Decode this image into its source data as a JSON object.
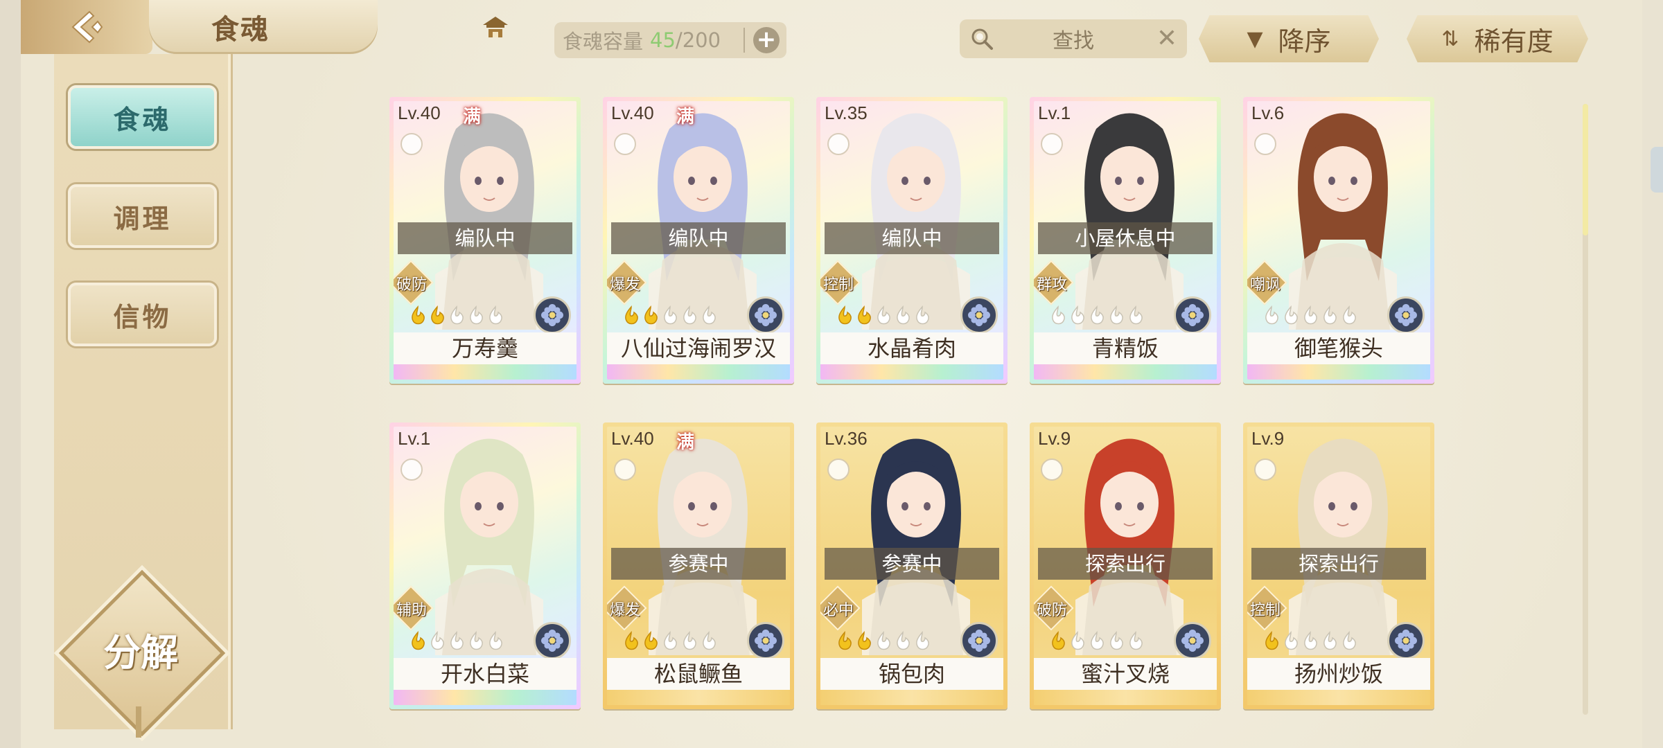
{
  "header": {
    "title": "食魂",
    "capacity_label": "食魂容量",
    "capacity_current": "45",
    "capacity_max": "/200",
    "search_placeholder": "查找",
    "sort_order_label": "降序",
    "sort_key_label": "稀有度"
  },
  "sidebar": {
    "items": [
      {
        "label": "食魂",
        "active": true
      },
      {
        "label": "调理",
        "active": false
      },
      {
        "label": "信物",
        "active": false
      }
    ],
    "decompose_label": "分解"
  },
  "colors": {
    "accent_active": "#8fd3ca",
    "capacity_current": "#8ecb72",
    "full_badge": "#c0251c"
  },
  "cards": [
    {
      "level": "Lv.40",
      "full": "满",
      "status": "编队中",
      "role": "破防",
      "name": "万寿羹",
      "frame": "rainbow",
      "stars": 2,
      "hair": "#bdbdbd"
    },
    {
      "level": "Lv.40",
      "full": "满",
      "status": "编队中",
      "role": "爆发",
      "name": "八仙过海闹罗汉",
      "frame": "rainbow",
      "stars": 2,
      "hair": "#b9c0e6"
    },
    {
      "level": "Lv.35",
      "full": "",
      "status": "编队中",
      "role": "控制",
      "name": "水晶肴肉",
      "frame": "rainbow",
      "stars": 2,
      "hair": "#e9e7ec"
    },
    {
      "level": "Lv.1",
      "full": "",
      "status": "小屋休息中",
      "role": "群攻",
      "name": "青精饭",
      "frame": "rainbow",
      "stars": 0,
      "hair": "#3a3a3c"
    },
    {
      "level": "Lv.6",
      "full": "",
      "status": "",
      "role": "嘲讽",
      "name": "御笔猴头",
      "frame": "rainbow",
      "stars": 0,
      "hair": "#8b4a2c"
    },
    {
      "level": "Lv.1",
      "full": "",
      "status": "",
      "role": "辅助",
      "name": "开水白菜",
      "frame": "rainbow",
      "stars": 1,
      "hair": "#dfe5c4"
    },
    {
      "level": "Lv.40",
      "full": "满",
      "status": "参赛中",
      "role": "爆发",
      "name": "松鼠鳜鱼",
      "frame": "gold",
      "stars": 2,
      "hair": "#e9e3d6"
    },
    {
      "level": "Lv.36",
      "full": "",
      "status": "参赛中",
      "role": "必中",
      "name": "锅包肉",
      "frame": "gold",
      "stars": 2,
      "hair": "#2b3550"
    },
    {
      "level": "Lv.9",
      "full": "",
      "status": "探索出行",
      "role": "破防",
      "name": "蜜汁叉烧",
      "frame": "gold",
      "stars": 1,
      "hair": "#c8412a"
    },
    {
      "level": "Lv.9",
      "full": "",
      "status": "探索出行",
      "role": "控制",
      "name": "扬州炒饭",
      "frame": "gold",
      "stars": 1,
      "hair": "#e8dcc0"
    }
  ]
}
